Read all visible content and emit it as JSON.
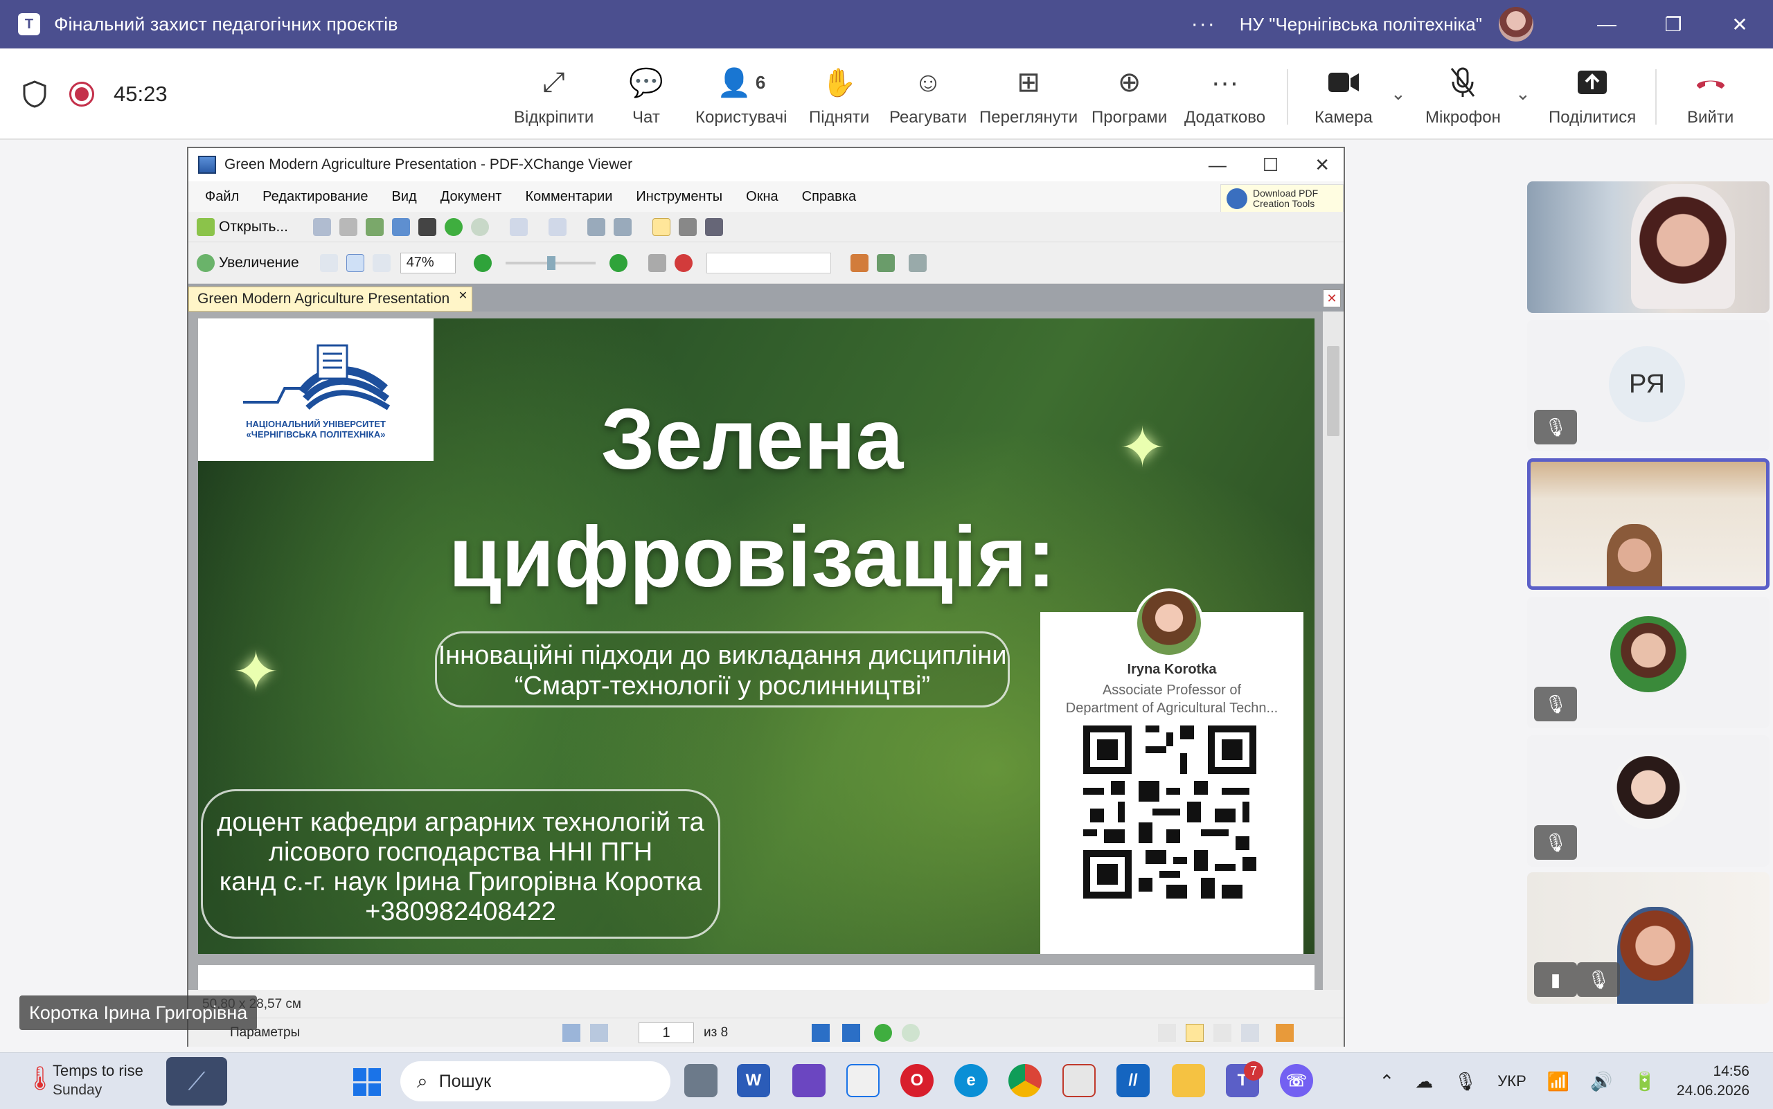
{
  "window": {
    "title": "Фінальний захист педагогічних проєктів",
    "org": "НУ \"Чернігівська політехніка\"",
    "more": "···"
  },
  "meeting": {
    "timer": "45:23",
    "toolbar": [
      {
        "label": "Відкріпити",
        "icon": "unpin-icon",
        "glyph": "⤢"
      },
      {
        "label": "Чат",
        "icon": "chat-icon",
        "glyph": "💬"
      },
      {
        "label": "Користувачі",
        "icon": "people-icon",
        "glyph": "👤",
        "count": "6"
      },
      {
        "label": "Підняти",
        "icon": "raise-hand-icon",
        "glyph": "✋"
      },
      {
        "label": "Реагувати",
        "icon": "react-icon",
        "glyph": "☺"
      },
      {
        "label": "Переглянути",
        "icon": "view-icon",
        "glyph": "⊞"
      },
      {
        "label": "Програми",
        "icon": "apps-icon",
        "glyph": "⊕"
      },
      {
        "label": "Додатково",
        "icon": "more-icon",
        "glyph": "···"
      }
    ],
    "camera": "Камера",
    "mic": "Мікрофон",
    "share": "Поділитися",
    "leave": "Вийти"
  },
  "viewer": {
    "title": "Green Modern Agriculture Presentation - PDF-XChange Viewer",
    "menu": [
      "Файл",
      "Редактирование",
      "Вид",
      "Документ",
      "Комментарии",
      "Инструменты",
      "Окна",
      "Справка"
    ],
    "download_line1": "Download PDF",
    "download_line2": "Creation Tools",
    "open_label": "Открыть...",
    "zoom_label": "Увеличение",
    "zoom_value": "47%",
    "tab": "Green Modern Agriculture Presentation",
    "dimensions": "50,80 x 28,57 см",
    "params": "Параметры",
    "page": "1",
    "page_of": "из 8"
  },
  "slide": {
    "logo_line1": "НАЦІОНАЛЬНИЙ УНІВЕРСИТЕТ",
    "logo_line2": "«ЧЕРНІГІВСЬКА ПОЛІТЕХНІКА»",
    "title_line1": "Зелена",
    "title_line2": "цифровізація:",
    "subtitle_line1": "Інноваційні підходи до викладання дисципліни",
    "subtitle_line2": "“Смарт-технології у рослинництві”",
    "info_line1": "доцент кафедри аграрних технологій та",
    "info_line2": "лісового господарства ННІ ПГН",
    "info_line3": "канд с.-г. наук Ірина Григорівна Коротка",
    "info_line4": "+380982408422",
    "card_name": "Iryna Korotka",
    "card_role1": "Associate Professor of",
    "card_role2": "Department of Agricultural Techn..."
  },
  "presenter_name": "Коротка Ірина Григорівна",
  "participants": {
    "initials": "РЯ"
  },
  "taskbar": {
    "weather_title": "Temps to rise",
    "weather_sub": "Sunday",
    "search_placeholder": "Пошук",
    "teams_badge": "7",
    "lang": "УКР",
    "time": "14:56",
    "date": "24.06.2026"
  },
  "colors": {
    "titlebar": "#4b4f8f",
    "accent": "#5b5fc7",
    "record": "#c4314b",
    "leave": "#c4314b"
  }
}
